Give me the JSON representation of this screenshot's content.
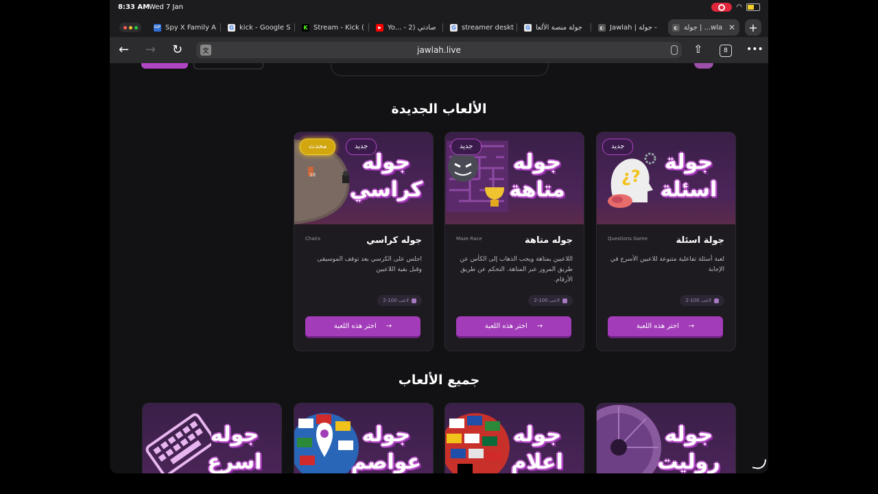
{
  "status_bar": {
    "time": "8:33 AM",
    "date": "Wed 7 Jan"
  },
  "tabs": [
    {
      "label": "Spy X Family A",
      "icon": "gif-icon",
      "favcolor": "#2f6fd8",
      "favtext": "GIF"
    },
    {
      "label": "kick - Google S",
      "icon": "google-icon",
      "favcolor": "#e8e8e8",
      "favtext": "G"
    },
    {
      "label": "Stream - Kick (",
      "icon": "kick-icon",
      "favcolor": "#53fc18",
      "favtext": "K"
    },
    {
      "label": "Yo... - صادتي (2",
      "icon": "youtube-icon",
      "favcolor": "#ff0000",
      "favtext": "▶"
    },
    {
      "label": "streamer deskt",
      "icon": "google-icon",
      "favcolor": "#e8e8e8",
      "favtext": "G"
    },
    {
      "label": "جولة منصة الألعا",
      "icon": "google-icon",
      "favcolor": "#e8e8e8",
      "favtext": "G"
    },
    {
      "label": "Jawlah | جولة -",
      "icon": "globe-icon",
      "favcolor": "#555555",
      "favtext": "◐"
    },
    {
      "label": "جولة | ...wla",
      "icon": "globe-icon",
      "favcolor": "#555555",
      "favtext": "◐"
    }
  ],
  "address_bar": {
    "url": "jawlah.live",
    "tab_count": "8"
  },
  "sections": {
    "new_games": "الألعاب الجديدة",
    "all_games": "جميع الألعاب"
  },
  "new_games": [
    {
      "banner_title": "جولة اسئلة",
      "badge": "جديد",
      "name": "جولة اسئلة",
      "english": "Questions Game",
      "desc": "لعبة أسئلة تفاعلية متنوعة للاعبين الأسرع في الإجابة",
      "players": "2-100 لاعب",
      "cta": "اختر هذه اللعبة"
    },
    {
      "banner_title": "جوله متاهة",
      "badge": "جديد",
      "name": "جوله متاهة",
      "english": "Maze Race",
      "desc": "اللاعبين بمتاهة ويجب الذهاب إلى الكأس عن طريق المرور عبر المتاهة. التحكم عن طريق الأرقام.",
      "players": "2-100 لاعب",
      "cta": "اختر هذه اللعبة"
    },
    {
      "banner_title": "جوله كراسي",
      "badge": "جديد",
      "badge_updated": "محدث",
      "name": "جوله كراسي",
      "english": "Chairs",
      "desc": "اجلس على الكرسي بعد توقف الموسيقى وقبل بقية اللاعبين",
      "players": "2-100 لاعب",
      "cta": "اختر هذه اللعبة",
      "seat_number": "10"
    }
  ],
  "all_games": [
    {
      "banner_title": "جوله روليت"
    },
    {
      "banner_title": "جوله اعلام"
    },
    {
      "banner_title": "جوله عواصم"
    },
    {
      "banner_title": "جوله اسرع"
    }
  ]
}
